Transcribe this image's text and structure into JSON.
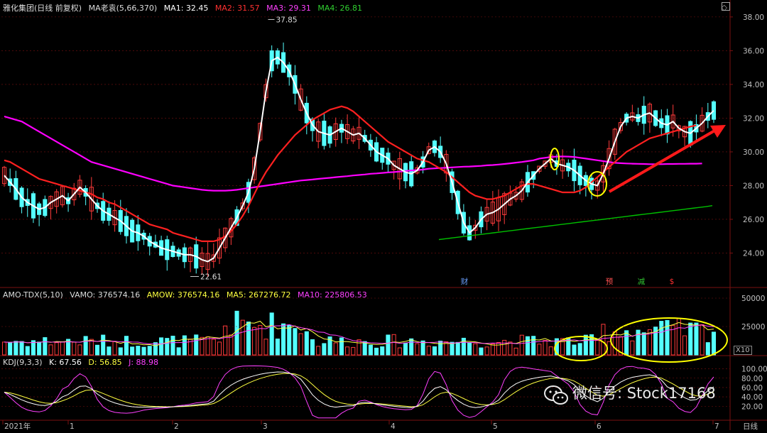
{
  "header": {
    "stock_title": "雅化集团(日线 前复权)",
    "ma_indicator": "MA老袁(5,66,370)",
    "ma1": "MA1: 32.45",
    "ma2": "MA2: 31.57",
    "ma3": "MA3: 29.31",
    "ma4": "MA4: 26.81"
  },
  "volume_header": {
    "indicator": "AMO-TDX(5,10)",
    "vamo": "VAMO: 376574.16",
    "amow": "AMOW: 376574.16",
    "ma5": "MA5: 267276.72",
    "ma10": "MA10: 225806.53"
  },
  "kdj_header": {
    "indicator": "KDJ(9,3,3)",
    "k": "K: 67.56",
    "d": "D: 56.85",
    "j": "J: 88.98"
  },
  "watermark": "微信号: Stock17168",
  "x10_label": "X10",
  "colors": {
    "up": "#ff3b3b",
    "down": "#54ffff",
    "ma1": "#ffffff",
    "ma2": "#ff2020",
    "ma3": "#ff00ff",
    "ma4": "#00c000",
    "arrow": "#ff1a1a",
    "circle": "#ffff00",
    "grid": "#7a1010",
    "axis_text": "#c0c0c0"
  },
  "chart_data": [
    {
      "type": "candlestick",
      "title": "雅化集团(日线 前复权)",
      "ylim": [
        22,
        38.5
      ],
      "y_ticks": [
        "24.00",
        "26.00",
        "28.00",
        "30.00",
        "32.00",
        "34.00",
        "36.00",
        "38.00"
      ],
      "price_high_annotation": "37.85",
      "price_low_annotation": "22.61",
      "event_markers": [
        "财",
        "预",
        "减",
        "$"
      ],
      "series_ma1": [
        28.6,
        28.2,
        27.8,
        27.3,
        27.0,
        26.8,
        26.6,
        26.7,
        27.0,
        27.2,
        27.4,
        27.1,
        27.5,
        27.9,
        27.6,
        27.2,
        26.8,
        26.5,
        26.3,
        26.1,
        25.9,
        25.6,
        25.3,
        25.2,
        25.0,
        24.7,
        24.5,
        24.3,
        24.2,
        24.1,
        24.0,
        23.9,
        23.9,
        23.8,
        23.6,
        23.5,
        23.7,
        24.3,
        24.9,
        25.5,
        26.1,
        26.8,
        27.6,
        29.0,
        31.2,
        33.6,
        35.4,
        35.6,
        35.3,
        34.8,
        34.0,
        33.1,
        32.3,
        31.6,
        31.2,
        31.1,
        31.0,
        31.2,
        31.4,
        31.2,
        31.0,
        31.1,
        30.8,
        30.4,
        30.0,
        29.8,
        29.6,
        29.2,
        29.0,
        28.8,
        28.7,
        28.9,
        29.4,
        30.1,
        30.3,
        30.0,
        29.3,
        28.2,
        27.0,
        25.8,
        25.2,
        25.5,
        26.0,
        26.3,
        26.4,
        26.6,
        26.9,
        27.2,
        27.4,
        27.7,
        28.2,
        28.6,
        29.0,
        29.3,
        29.6,
        29.3,
        29.2,
        29.1,
        28.9,
        28.6,
        28.3,
        28.1,
        28.0,
        28.7,
        29.6,
        30.6,
        31.5,
        32.0,
        32.1,
        32.0,
        32.2,
        32.3,
        32.0,
        31.7,
        31.6,
        31.8,
        31.4,
        31.2,
        31.1,
        31.4,
        31.7,
        32.1,
        32.45
      ],
      "series_ma2": [
        29.5,
        29.4,
        29.2,
        29.0,
        28.8,
        28.6,
        28.4,
        28.3,
        28.2,
        28.1,
        28.0,
        27.9,
        27.8,
        27.7,
        27.6,
        27.5,
        27.3,
        27.2,
        27.0,
        26.9,
        26.7,
        26.5,
        26.3,
        26.1,
        25.9,
        25.7,
        25.6,
        25.5,
        25.4,
        25.2,
        25.1,
        25.0,
        24.9,
        24.8,
        24.7,
        24.7,
        24.7,
        24.8,
        25.0,
        25.3,
        25.7,
        26.2,
        26.8,
        27.5,
        28.2,
        28.8,
        29.3,
        29.8,
        30.2,
        30.6,
        31.0,
        31.3,
        31.6,
        31.9,
        32.1,
        32.3,
        32.5,
        32.6,
        32.7,
        32.6,
        32.4,
        32.1,
        31.8,
        31.5,
        31.2,
        30.9,
        30.6,
        30.4,
        30.2,
        30.0,
        29.8,
        29.6,
        29.5,
        29.4,
        29.2,
        29.0,
        28.8,
        28.5,
        28.2,
        27.9,
        27.6,
        27.4,
        27.3,
        27.2,
        27.2,
        27.3,
        27.4,
        27.6,
        27.8,
        28.0,
        28.1,
        28.1,
        28.0,
        27.9,
        27.8,
        27.7,
        27.6,
        27.6,
        27.6,
        27.7,
        27.9,
        28.2,
        28.5,
        28.8,
        29.1,
        29.4,
        29.7,
        30.0,
        30.2,
        30.4,
        30.6,
        30.8,
        30.9,
        31.0,
        31.1,
        31.2,
        31.3,
        31.4,
        31.5,
        31.57
      ],
      "series_ma3": [
        32.1,
        32.0,
        31.9,
        31.8,
        31.6,
        31.4,
        31.2,
        31.0,
        30.8,
        30.6,
        30.4,
        30.2,
        30.0,
        29.8,
        29.6,
        29.4,
        29.3,
        29.2,
        29.1,
        29.0,
        28.9,
        28.8,
        28.7,
        28.6,
        28.5,
        28.4,
        28.3,
        28.2,
        28.1,
        28.0,
        27.95,
        27.9,
        27.85,
        27.8,
        27.75,
        27.72,
        27.7,
        27.7,
        27.7,
        27.72,
        27.75,
        27.8,
        27.85,
        27.9,
        27.95,
        28.0,
        28.05,
        28.1,
        28.15,
        28.2,
        28.25,
        28.3,
        28.33,
        28.36,
        28.4,
        28.43,
        28.46,
        28.5,
        28.53,
        28.56,
        28.6,
        28.63,
        28.66,
        28.7,
        28.72,
        28.75,
        28.78,
        28.8,
        28.83,
        28.86,
        28.9,
        28.92,
        28.95,
        29.0,
        29.02,
        29.04,
        29.06,
        29.08,
        29.1,
        29.12,
        29.13,
        29.15,
        29.17,
        29.2,
        29.22,
        29.25,
        29.28,
        29.32,
        29.36,
        29.4,
        29.45,
        29.5,
        29.6,
        29.65,
        29.7,
        29.72,
        29.73,
        29.72,
        29.7,
        29.65,
        29.6,
        29.55,
        29.5,
        29.45,
        29.4,
        29.35,
        29.33,
        29.31,
        29.3,
        29.29,
        29.28,
        29.27,
        29.27,
        29.27,
        29.28,
        29.28,
        29.29,
        29.29,
        29.3,
        29.3,
        29.31
      ],
      "series_ma4": [
        24.8,
        24.85,
        24.9,
        24.95,
        25.0,
        25.05,
        25.1,
        25.15,
        25.2,
        25.25,
        25.3,
        25.35,
        25.4,
        25.45,
        25.5,
        25.55,
        25.6,
        25.65,
        25.7,
        25.75,
        25.8,
        25.85,
        25.9,
        25.95,
        26.0,
        26.05,
        26.1,
        26.15,
        26.2,
        26.25,
        26.3,
        26.35,
        26.4,
        26.45,
        26.5,
        26.55,
        26.6,
        26.65,
        26.7,
        26.75,
        26.81
      ]
    },
    {
      "type": "bar",
      "title": "AMO-TDX(5,10)",
      "y_ticks": [
        "25000",
        "50000"
      ],
      "series": [
        {
          "name": "MA5"
        },
        {
          "name": "MA10"
        }
      ]
    },
    {
      "type": "line",
      "title": "KDJ(9,3,3)",
      "y_ticks": [
        "20.00",
        "40.00",
        "60.00",
        "80.00",
        "100.00"
      ],
      "series": [
        {
          "name": "K"
        },
        {
          "name": "D"
        },
        {
          "name": "J"
        }
      ]
    }
  ],
  "x_axis": {
    "labels": [
      "2021年",
      "1",
      "2",
      "3",
      "4",
      "5",
      "6",
      "7"
    ],
    "right_label": "日线"
  }
}
